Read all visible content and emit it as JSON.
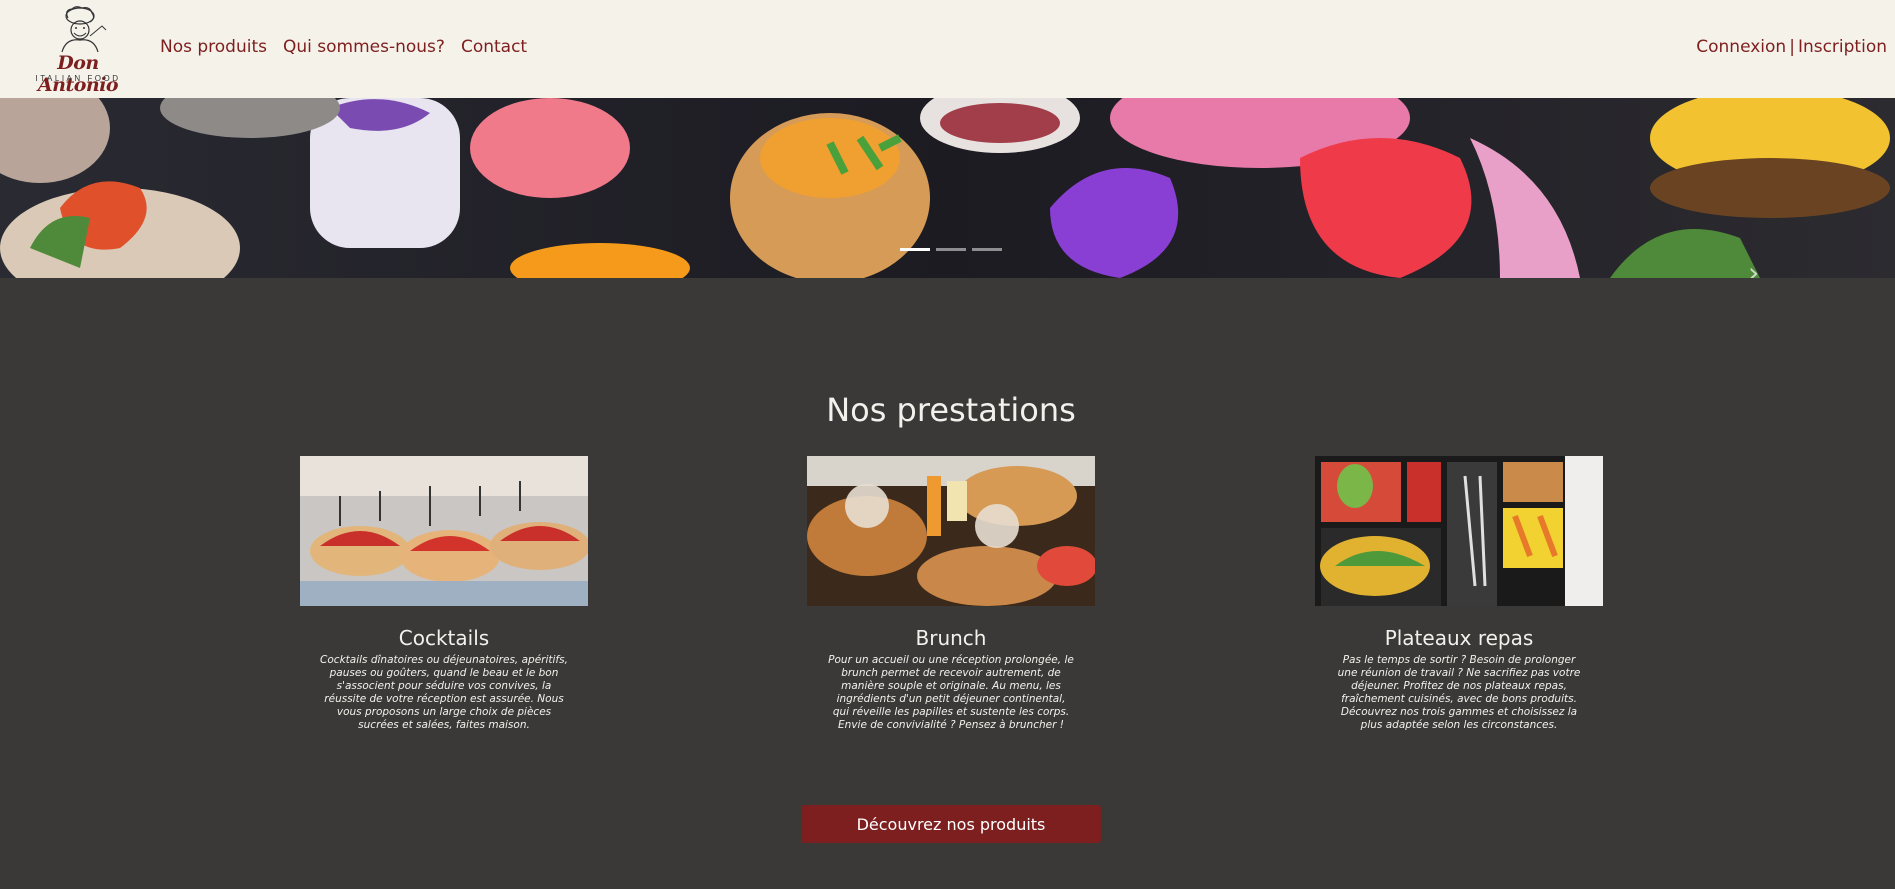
{
  "header": {
    "logo_script": "Don Antonio",
    "logo_sub": "ITALIAN FOOD",
    "nav": [
      "Nos produits",
      "Qui sommes-nous?",
      "Contact"
    ],
    "auth": {
      "login": "Connexion",
      "separator": "|",
      "signup": "Inscription"
    }
  },
  "carousel": {
    "slides_count": 3,
    "active_slide": 1,
    "next_icon": "chevron-right-icon"
  },
  "section": {
    "title": "Nos prestations",
    "cards": [
      {
        "title": "Cocktails",
        "text": "Cocktails dînatoires ou déjeunatoires, apéritifs, pauses ou goûters, quand le beau et le bon s'associent pour séduire vos convives, la réussite de votre réception est assurée. Nous vous proposons un large choix de pièces sucrées et salées, faites maison."
      },
      {
        "title": "Brunch",
        "text": "Pour un accueil ou une réception prolongée, le brunch permet de recevoir autrement, de manière souple et originale. Au menu, les ingrédients d'un petit déjeuner continental, qui réveille les papilles et sustente les corps. Envie de convivialité ? Pensez à bruncher !"
      },
      {
        "title": "Plateaux repas",
        "text": "Pas le temps de sortir ? Besoin de prolonger une réunion de travail ? Ne sacrifiez pas votre déjeuner. Profitez de nos plateaux repas, fraîchement cuisinés, avec de bons produits. Découvrez nos trois gammes et choisissez la plus adaptée selon les circonstances."
      }
    ],
    "cta": "Découvrez nos produits"
  },
  "colors": {
    "brand": "#7d1f1f",
    "header_bg": "#f5f2ea",
    "body_bg": "#3a3937"
  }
}
